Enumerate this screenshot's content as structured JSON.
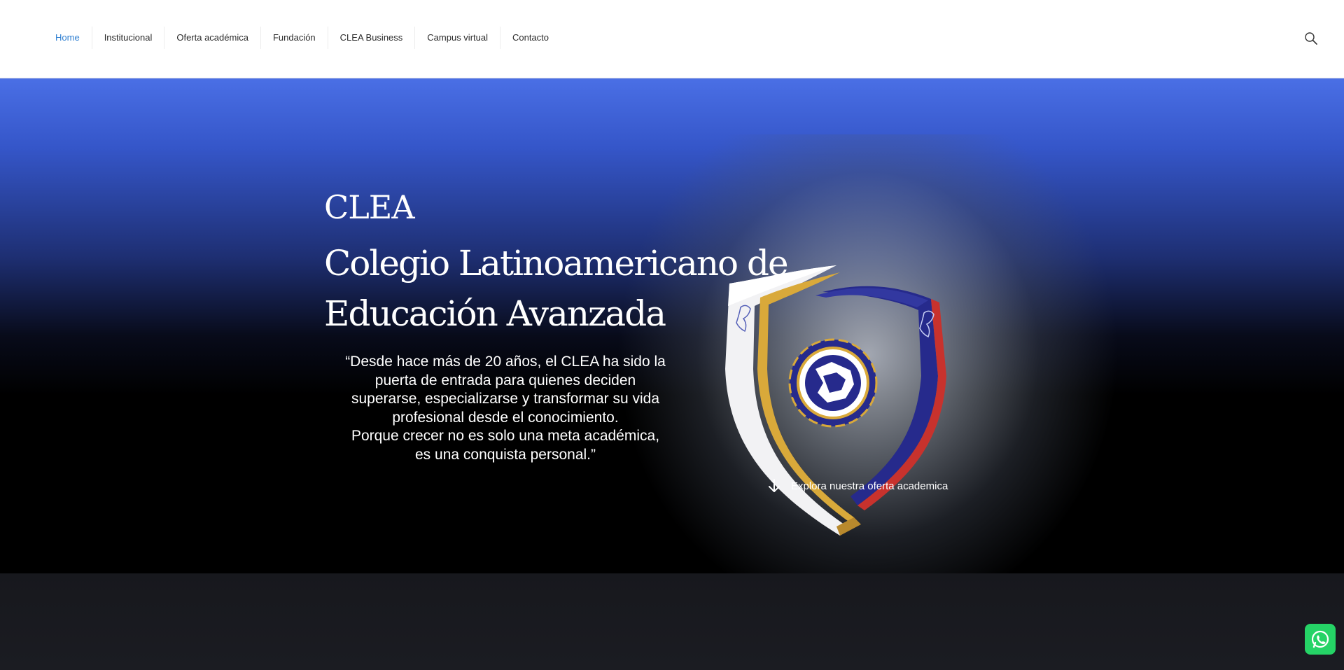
{
  "nav": {
    "items": [
      {
        "label": "Home",
        "active": true
      },
      {
        "label": "Institucional"
      },
      {
        "label": "Oferta académica"
      },
      {
        "label": "Fundación"
      },
      {
        "label": "CLEA Business"
      },
      {
        "label": "Campus virtual"
      },
      {
        "label": "Contacto"
      }
    ],
    "search_icon": "search-icon"
  },
  "hero": {
    "brand": "CLEA",
    "headline_line1": "Colegio Latinoamericano de",
    "headline_line2": "Educación Avanzada",
    "quote_lines": [
      "“Desde hace más de 20 años, el CLEA ha sido la",
      "puerta de entrada para quienes deciden",
      "superarse, especializarse y transformar su vida",
      "profesional desde el conocimiento.",
      "Porque crecer no es solo una meta académica,",
      "es una conquista personal.”"
    ],
    "explore_label": "Explora nuestra oferta academica",
    "explore_icon": "arrow-down-icon",
    "logo_icon": "shield-logo-icon"
  },
  "whatsapp": {
    "icon": "whatsapp-icon"
  },
  "colors": {
    "accent": "#2f7fd1",
    "hero_blue": "#4a6fe5",
    "shield_navy": "#262a8c",
    "shield_red": "#c8322d",
    "shield_gold": "#d9a93a",
    "whatsapp": "#25d366"
  }
}
